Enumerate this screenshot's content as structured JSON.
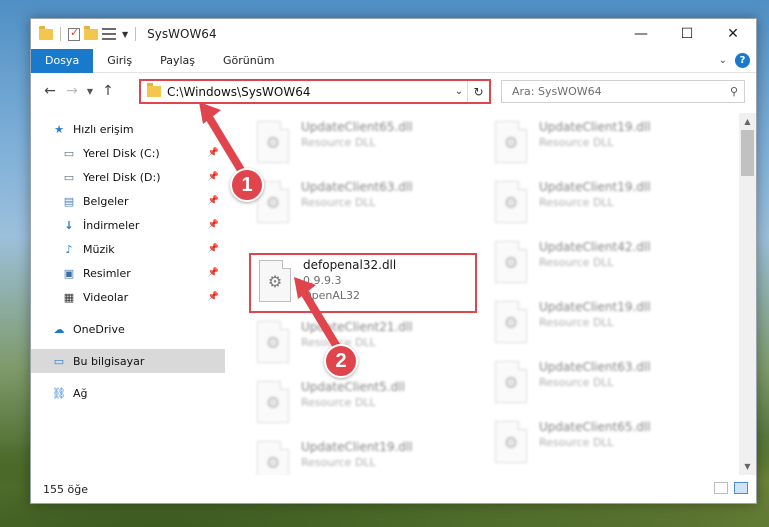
{
  "window": {
    "title": "SysWOW64",
    "controls": {
      "minimize": "—",
      "maximize": "☐",
      "close": "✕"
    }
  },
  "ribbon": {
    "tabs": [
      "Dosya",
      "Giriş",
      "Paylaş",
      "Görünüm"
    ],
    "active_tab": "Dosya",
    "help": "?"
  },
  "navigation": {
    "address_path": "C:\\Windows\\SysWOW64",
    "search_placeholder": "Ara: SysWOW64"
  },
  "sidebar": {
    "items": [
      {
        "label": "Hızlı erişim",
        "icon": "star-icon",
        "pinned": false,
        "selected": false
      },
      {
        "label": "Yerel Disk (C:)",
        "icon": "drive-icon",
        "pinned": true,
        "selected": false
      },
      {
        "label": "Yerel Disk (D:)",
        "icon": "drive-icon",
        "pinned": true,
        "selected": false
      },
      {
        "label": "Belgeler",
        "icon": "documents-icon",
        "pinned": true,
        "selected": false
      },
      {
        "label": "İndirmeler",
        "icon": "download-icon",
        "pinned": true,
        "selected": false
      },
      {
        "label": "Müzik",
        "icon": "music-icon",
        "pinned": true,
        "selected": false
      },
      {
        "label": "Resimler",
        "icon": "pictures-icon",
        "pinned": true,
        "selected": false
      },
      {
        "label": "Videolar",
        "icon": "video-icon",
        "pinned": true,
        "selected": false
      },
      {
        "label": "OneDrive",
        "icon": "cloud-icon",
        "pinned": false,
        "selected": false
      },
      {
        "label": "Bu bilgisayar",
        "icon": "computer-icon",
        "pinned": false,
        "selected": true
      },
      {
        "label": "Ağ",
        "icon": "network-icon",
        "pinned": false,
        "selected": false
      }
    ]
  },
  "files": {
    "left_column": [
      {
        "name": "UpdateClient65.dll",
        "line2": "Resource DLL",
        "line3": ""
      },
      {
        "name": "UpdateClient63.dll",
        "line2": "Resource DLL",
        "line3": ""
      },
      {
        "name": "defopenal32.dll",
        "line2": "0.9.9.3",
        "line3": "OpenAL32"
      },
      {
        "name": "UpdateClient21.dll",
        "line2": "Resource DLL",
        "line3": ""
      },
      {
        "name": "UpdateClient5.dll",
        "line2": "Resource DLL",
        "line3": ""
      },
      {
        "name": "UpdateClient19.dll",
        "line2": "Resource DLL",
        "line3": ""
      }
    ],
    "right_column": [
      {
        "name": "UpdateClient19.dll",
        "line2": "Resource DLL"
      },
      {
        "name": "UpdateClient19.dll",
        "line2": "Resource DLL"
      },
      {
        "name": "UpdateClient42.dll",
        "line2": "Resource DLL"
      },
      {
        "name": "UpdateClient19.dll",
        "line2": "Resource DLL"
      },
      {
        "name": "UpdateClient63.dll",
        "line2": "Resource DLL"
      },
      {
        "name": "UpdateClient65.dll",
        "line2": "Resource DLL"
      }
    ]
  },
  "status": {
    "item_count": "155 öğe"
  },
  "annotations": {
    "badge_1": "1",
    "badge_2": "2",
    "color": "#e0444c"
  }
}
